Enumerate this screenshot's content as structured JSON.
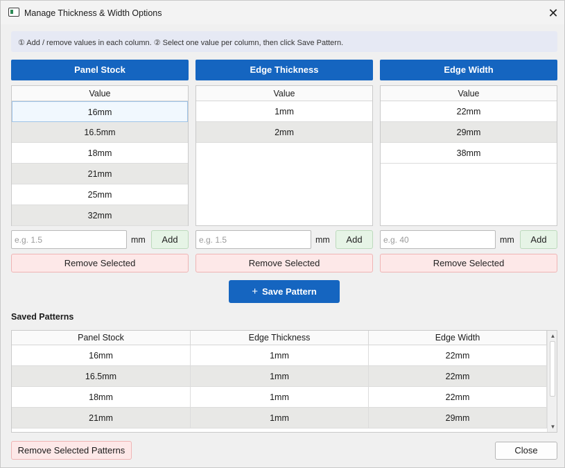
{
  "window": {
    "title": "Manage Thickness & Width Options",
    "close_glyph": "✕"
  },
  "hint": "① Add / remove values in each column. ② Select one value per column, then click  Save Pattern.",
  "columns": [
    {
      "header": "Panel Stock",
      "list_header": "Value",
      "values": [
        "16mm",
        "16.5mm",
        "18mm",
        "21mm",
        "25mm",
        "32mm"
      ],
      "input_placeholder": "e.g. 1.5",
      "unit": "mm",
      "add_label": "Add",
      "remove_label": "Remove Selected"
    },
    {
      "header": "Edge Thickness",
      "list_header": "Value",
      "values": [
        "1mm",
        "2mm"
      ],
      "input_placeholder": "e.g. 1.5",
      "unit": "mm",
      "add_label": "Add",
      "remove_label": "Remove Selected"
    },
    {
      "header": "Edge Width",
      "list_header": "Value",
      "values": [
        "22mm",
        "29mm",
        "38mm"
      ],
      "input_placeholder": "e.g. 40",
      "unit": "mm",
      "add_label": "Add",
      "remove_label": "Remove Selected"
    }
  ],
  "save_pattern": {
    "icon": "plus-icon",
    "glyph": "+",
    "label": "Save Pattern"
  },
  "saved_patterns": {
    "title": "Saved Patterns",
    "headers": [
      "Panel Stock",
      "Edge Thickness",
      "Edge Width"
    ],
    "rows": [
      [
        "16mm",
        "1mm",
        "22mm"
      ],
      [
        "16.5mm",
        "1mm",
        "22mm"
      ],
      [
        "18mm",
        "1mm",
        "22mm"
      ],
      [
        "21mm",
        "1mm",
        "29mm"
      ]
    ]
  },
  "footer": {
    "remove_patterns_label": "Remove Selected Patterns",
    "close_label": "Close"
  },
  "colors": {
    "accent": "#1565c0",
    "add_bg": "#e6f4e6",
    "remove_bg": "#fde8e8",
    "row_alt": "#e8e8e6"
  }
}
